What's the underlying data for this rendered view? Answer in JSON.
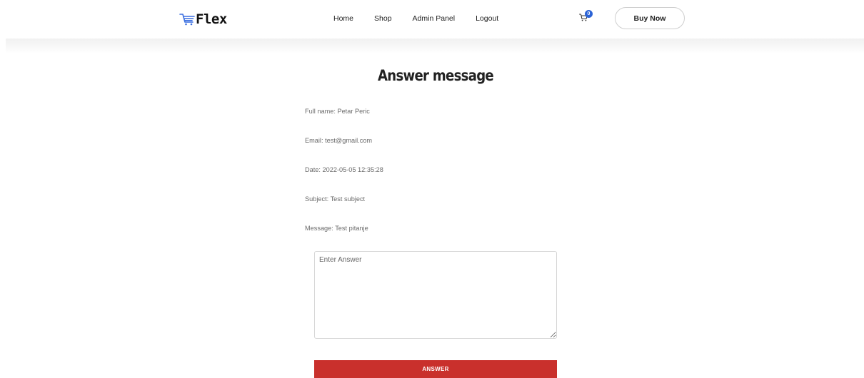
{
  "brand": {
    "name": "Flex",
    "accent_color": "#3b6fe0"
  },
  "nav": {
    "items": [
      "Home",
      "Shop",
      "Admin Panel",
      "Logout"
    ],
    "cart_count": "0",
    "cart_icon": "shopping-cart-icon",
    "buy_now_label": "Buy Now"
  },
  "page": {
    "title": "Answer message"
  },
  "message": {
    "full_name": "Full name: Petar Peric",
    "email": "Email: test@gmail.com",
    "date": "Date: 2022-05-05 12:35:28",
    "subject": "Subject: Test subject",
    "message": "Message: Test pitanje"
  },
  "form": {
    "answer_value": "",
    "answer_placeholder": "Enter Answer",
    "submit_label": "ANSWER",
    "submit_color": "#c9302c"
  }
}
